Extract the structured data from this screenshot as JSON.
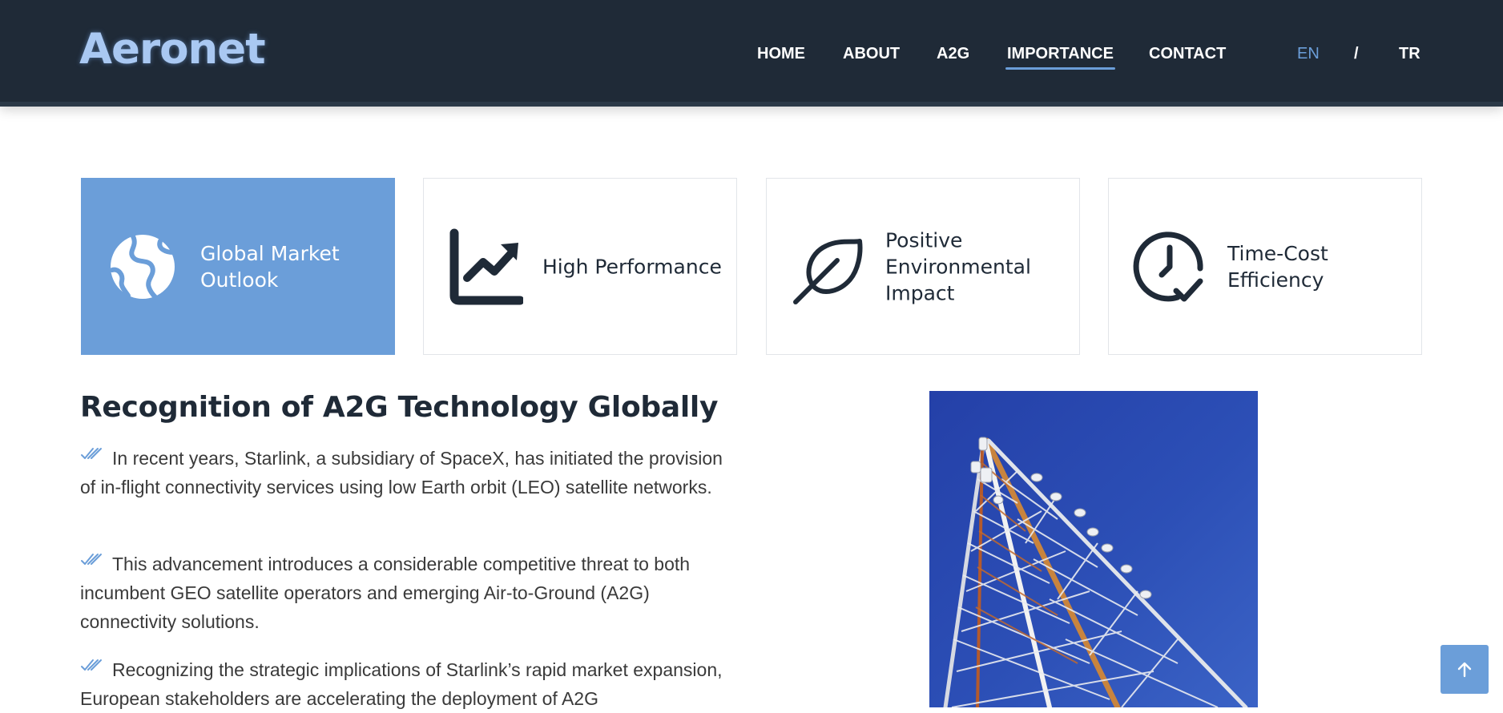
{
  "header": {
    "logo": "Aeronet",
    "nav": [
      {
        "label": "HOME"
      },
      {
        "label": "ABOUT"
      },
      {
        "label": "A2G"
      },
      {
        "label": "IMPORTANCE",
        "active": true
      },
      {
        "label": "CONTACT"
      }
    ],
    "lang": {
      "en": "EN",
      "separator": "/",
      "tr": "TR"
    }
  },
  "features": [
    {
      "label": "Global Market Outlook",
      "icon": "globe-icon",
      "selected": true
    },
    {
      "label": "High Performance",
      "icon": "chart-line-up-icon",
      "selected": false
    },
    {
      "label": "Positive Environmental Impact",
      "icon": "leaf-icon",
      "selected": false
    },
    {
      "label": "Time-Cost Efficiency",
      "icon": "clock-check-icon",
      "selected": false
    }
  ],
  "article": {
    "title": "Recognition of A2G Technology Globally",
    "paragraphs": [
      "In recent years, Starlink, a subsidiary of SpaceX, has initiated the provision of in-flight connectivity services using low Earth orbit (LEO) satellite networks.",
      "This advancement introduces a considerable competitive threat to both incumbent GEO satellite operators and emerging Air-to-Ground (A2G) connectivity solutions.",
      "Recognizing the strategic implications of Starlink’s rapid market expansion, European stakeholders are accelerating the deployment of A2G"
    ]
  },
  "colors": {
    "header_bg": "#1f2a37",
    "accent": "#6b9ed9",
    "heading": "#1f2a37",
    "body_text": "#3a3a3a"
  },
  "image": {
    "subject": "telecommunication-tower-photo"
  },
  "scroll_top": {
    "icon": "arrow-up-icon"
  }
}
